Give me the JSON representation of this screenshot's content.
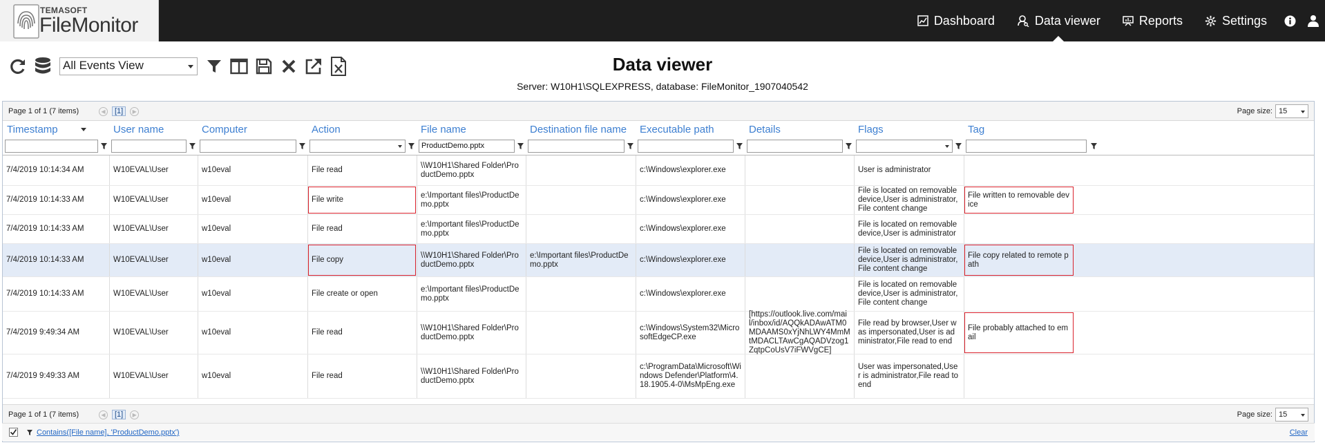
{
  "app": {
    "brand_small": "TEMASOFT",
    "brand_big": "FileMonitor"
  },
  "nav": {
    "dashboard": "Dashboard",
    "data_viewer": "Data viewer",
    "reports": "Reports",
    "settings": "Settings"
  },
  "toolbar": {
    "view_value": "All Events View"
  },
  "page": {
    "title": "Data viewer",
    "subtitle": "Server: W10H1\\SQLEXPRESS, database: FileMonitor_1907040542"
  },
  "pager": {
    "info": "Page 1 of 1 (7 items)",
    "current": "[1]",
    "size_label": "Page size:",
    "size_value": "15"
  },
  "columns": [
    "Timestamp",
    "User name",
    "Computer",
    "Action",
    "File name",
    "Destination file name",
    "Executable path",
    "Details",
    "Flags",
    "Tag"
  ],
  "filters": {
    "file_name": "ProductDemo.pptx"
  },
  "rows": [
    {
      "timestamp": "7/4/2019 10:14:34 AM",
      "user": "W10EVAL\\User",
      "computer": "w10eval",
      "action": "File read",
      "file": "\\\\W10H1\\Shared Folder\\ProductDemo.pptx",
      "dest": "",
      "exe": "c:\\Windows\\explorer.exe",
      "details": "",
      "flags": "User is administrator",
      "tag": ""
    },
    {
      "timestamp": "7/4/2019 10:14:33 AM",
      "user": "W10EVAL\\User",
      "computer": "w10eval",
      "action": "File write",
      "file": "e:\\Important files\\ProductDemo.pptx",
      "dest": "",
      "exe": "c:\\Windows\\explorer.exe",
      "details": "",
      "flags": "File is located on removable device,User is administrator,File content change",
      "tag": "File written to removable device"
    },
    {
      "timestamp": "7/4/2019 10:14:33 AM",
      "user": "W10EVAL\\User",
      "computer": "w10eval",
      "action": "File read",
      "file": "e:\\Important files\\ProductDemo.pptx",
      "dest": "",
      "exe": "c:\\Windows\\explorer.exe",
      "details": "",
      "flags": "File is located on removable device,User is administrator",
      "tag": ""
    },
    {
      "timestamp": "7/4/2019 10:14:33 AM",
      "user": "W10EVAL\\User",
      "computer": "w10eval",
      "action": "File copy",
      "file": "\\\\W10H1\\Shared Folder\\ProductDemo.pptx",
      "dest": "e:\\Important files\\ProductDemo.pptx",
      "exe": "c:\\Windows\\explorer.exe",
      "details": "",
      "flags": "File is located on removable device,User is administrator,File content change",
      "tag": "File copy related to remote path"
    },
    {
      "timestamp": "7/4/2019 10:14:33 AM",
      "user": "W10EVAL\\User",
      "computer": "w10eval",
      "action": "File create or open",
      "file": "e:\\Important files\\ProductDemo.pptx",
      "dest": "",
      "exe": "c:\\Windows\\explorer.exe",
      "details": "",
      "flags": "File is located on removable device,User is administrator,File content change",
      "tag": ""
    },
    {
      "timestamp": "7/4/2019 9:49:34 AM",
      "user": "W10EVAL\\User",
      "computer": "w10eval",
      "action": "File read",
      "file": "\\\\W10H1\\Shared Folder\\ProductDemo.pptx",
      "dest": "",
      "exe": "c:\\Windows\\System32\\MicrosoftEdgeCP.exe",
      "details": "[https://outlook.live.com/mail/inbox/id/AQQkADAwATM0MDAAMS0xYjNhLWY4MmMtMDACLTAwCgAQADVzog1ZqtpCoUsV7iFWVgCE]",
      "flags": "File read by browser,User was impersonated,User is administrator,File read to end",
      "tag": "File probably attached to email"
    },
    {
      "timestamp": "7/4/2019 9:49:33 AM",
      "user": "W10EVAL\\User",
      "computer": "w10eval",
      "action": "File read",
      "file": "\\\\W10H1\\Shared Folder\\ProductDemo.pptx",
      "dest": "",
      "exe": "c:\\ProgramData\\Microsoft\\Windows Defender\\Platform\\4.18.1905.4-0\\MsMpEng.exe",
      "details": "",
      "flags": "User was impersonated,User is administrator,File read to end",
      "tag": ""
    }
  ],
  "footer": {
    "filter_expression": "Contains([File name], 'ProductDemo.pptx')",
    "clear": "Clear"
  }
}
